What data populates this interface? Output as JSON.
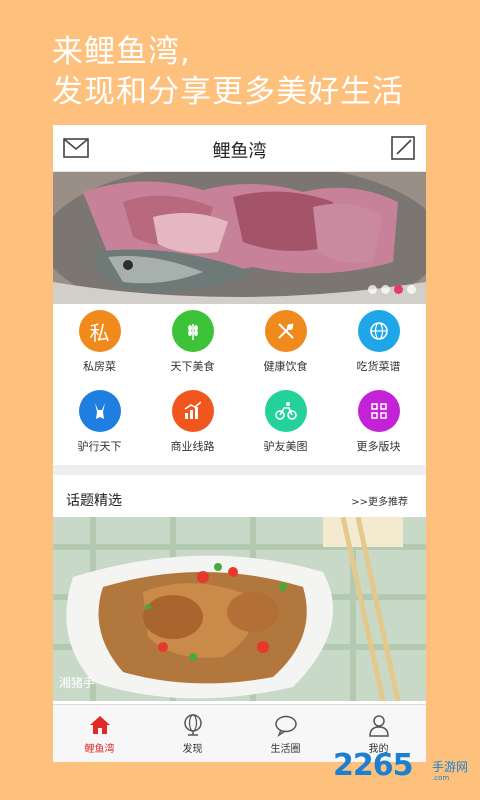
{
  "promo": {
    "line1": "来鲤鱼湾,",
    "line2": "发现和分享更多美好生活"
  },
  "header": {
    "title": "鲤鱼湾",
    "left_icon": "mail-icon",
    "right_icon": "compose-icon"
  },
  "banner": {
    "active_dot_index": 3,
    "dot_count": 4,
    "colors": {
      "active": "#E23B6E"
    }
  },
  "grid": {
    "items": [
      {
        "label": "私房菜",
        "glyph": "私",
        "color": "#F08A1C",
        "icon": "private-kitchen-icon"
      },
      {
        "label": "天下美食",
        "glyph": "",
        "color": "#3DC339",
        "icon": "wheat-icon"
      },
      {
        "label": "健康饮食",
        "glyph": "",
        "color": "#F08A1C",
        "icon": "healthy-food-icon"
      },
      {
        "label": "吃货菜谱",
        "glyph": "",
        "color": "#1FA6E8",
        "icon": "globe-recipe-icon"
      },
      {
        "label": "驴行天下",
        "glyph": "",
        "color": "#1F7FE0",
        "icon": "donkey-icon"
      },
      {
        "label": "商业线路",
        "glyph": "",
        "color": "#F0561E",
        "icon": "chart-icon"
      },
      {
        "label": "驴友美图",
        "glyph": "",
        "color": "#23D29A",
        "icon": "bicycle-icon"
      },
      {
        "label": "更多版块",
        "glyph": "",
        "color": "#C522D8",
        "icon": "grid-icon"
      }
    ]
  },
  "section": {
    "title": "话题精选",
    "more": ">>更多推荐"
  },
  "photo": {
    "caption": "湘猪手"
  },
  "tabbar": {
    "items": [
      {
        "label": "鲤鱼湾",
        "icon": "home-icon"
      },
      {
        "label": "发现",
        "icon": "globe-icon"
      },
      {
        "label": "生活圈",
        "icon": "chat-bubble-icon"
      },
      {
        "label": "我的",
        "icon": "user-icon"
      }
    ],
    "active_index": 0,
    "colors": {
      "active": "#E02A2A"
    }
  },
  "watermark": {
    "brand": "2265",
    "site": "手游网",
    "domain": ".com"
  }
}
